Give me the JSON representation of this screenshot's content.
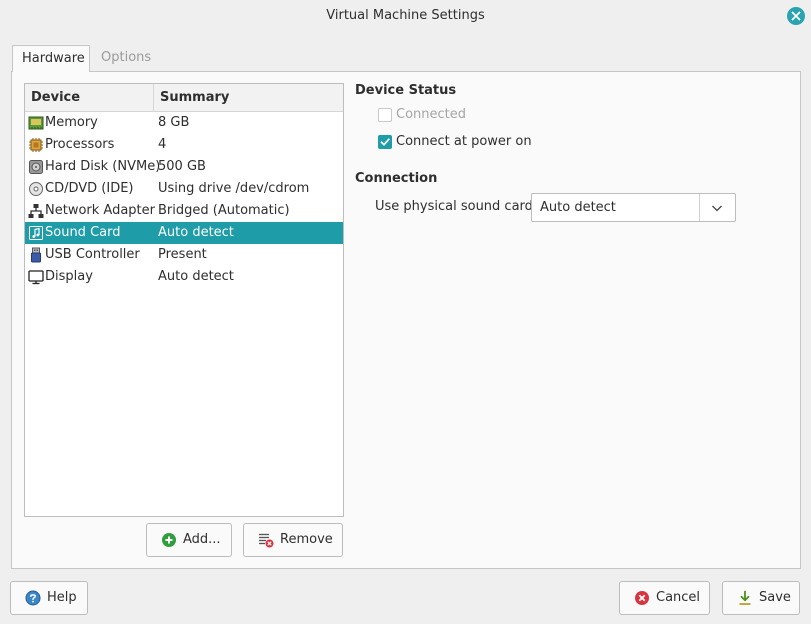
{
  "window": {
    "title": "Virtual Machine Settings",
    "close_icon": "close-icon"
  },
  "tabs": [
    {
      "label": "Hardware",
      "active": true
    },
    {
      "label": "Options",
      "active": false
    }
  ],
  "device_list": {
    "columns": {
      "device": "Device",
      "summary": "Summary"
    },
    "rows": [
      {
        "icon": "memory-icon",
        "name": "Memory",
        "summary": "8 GB",
        "selected": false
      },
      {
        "icon": "processor-icon",
        "name": "Processors",
        "summary": "4",
        "selected": false
      },
      {
        "icon": "hard-disk-icon",
        "name": "Hard Disk (NVMe)",
        "summary": "500 GB",
        "selected": false
      },
      {
        "icon": "cd-dvd-icon",
        "name": "CD/DVD (IDE)",
        "summary": "Using drive /dev/cdrom",
        "selected": false
      },
      {
        "icon": "network-icon",
        "name": "Network Adapter",
        "summary": "Bridged (Automatic)",
        "selected": false
      },
      {
        "icon": "sound-card-icon",
        "name": "Sound Card",
        "summary": "Auto detect",
        "selected": true
      },
      {
        "icon": "usb-icon",
        "name": "USB Controller",
        "summary": "Present",
        "selected": false
      },
      {
        "icon": "display-icon",
        "name": "Display",
        "summary": "Auto detect",
        "selected": false
      }
    ]
  },
  "list_buttons": {
    "add": "Add...",
    "remove": "Remove"
  },
  "device_status": {
    "title": "Device Status",
    "connected": {
      "label": "Connected",
      "checked": false,
      "enabled": false
    },
    "connect_at_power_on": {
      "label": "Connect at power on",
      "checked": true,
      "enabled": true
    }
  },
  "connection": {
    "title": "Connection",
    "sound_card_label": "Use physical sound card:",
    "sound_card_value": "Auto detect"
  },
  "footer": {
    "help": "Help",
    "cancel": "Cancel",
    "save": "Save"
  },
  "colors": {
    "accent": "#1e9ca8",
    "cancel_red": "#d9333f",
    "add_green": "#2e9e3e",
    "help_blue": "#3a86c8"
  }
}
